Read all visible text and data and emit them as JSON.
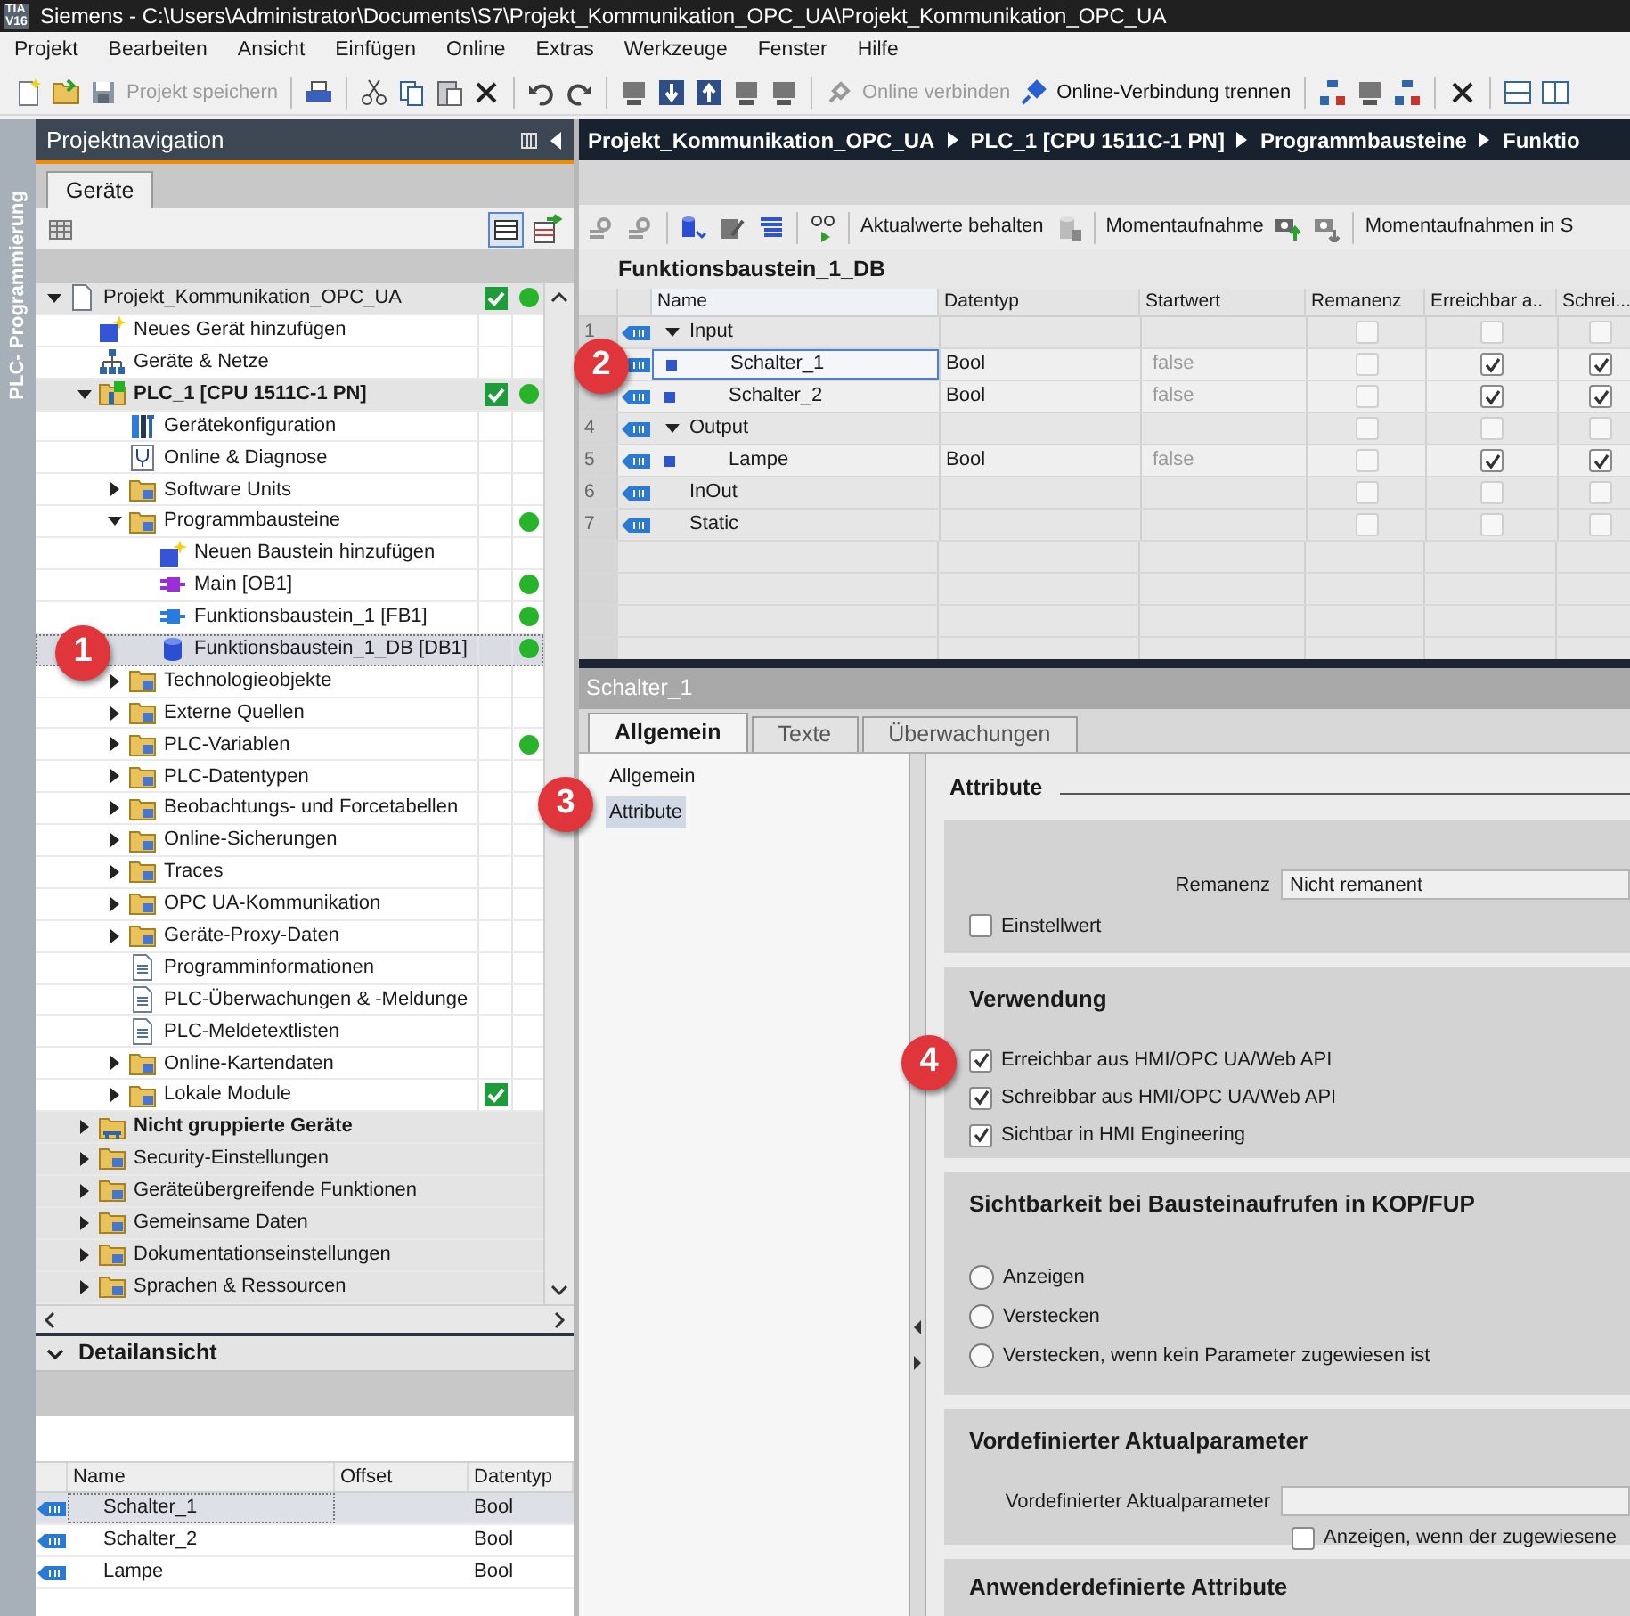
{
  "window": {
    "logo": [
      "TIA",
      "V16"
    ],
    "title": "Siemens  -  C:\\Users\\Administrator\\Documents\\S7\\Projekt_Kommunikation_OPC_UA\\Projekt_Kommunikation_OPC_UA"
  },
  "menu": [
    "Projekt",
    "Bearbeiten",
    "Ansicht",
    "Einfügen",
    "Online",
    "Extras",
    "Werkzeuge",
    "Fenster",
    "Hilfe"
  ],
  "toolbar": [
    {
      "label": "Projekt speichern",
      "disabled": true
    },
    {
      "label": "Online verbinden",
      "disabled": true
    },
    {
      "label": "Online-Verbindung trennen",
      "disabled": false
    }
  ],
  "side_tab": "PLC- Programmierung",
  "project_navigation": {
    "title": "Projektnavigation",
    "tab": "Geräte",
    "tree": [
      {
        "label": "Projekt_Kommunikation_OPC_UA",
        "kind": "project",
        "expanded": true,
        "consistent": true,
        "online_ok": true,
        "selected": false,
        "children": [
          {
            "label": "Neues Gerät hinzufügen",
            "kind": "add",
            "consistent": false,
            "online_ok": false,
            "selected": false
          },
          {
            "label": "Geräte & Netze",
            "kind": "network",
            "consistent": false,
            "online_ok": false,
            "selected": false
          },
          {
            "label": "PLC_1 [CPU 1511C-1 PN]",
            "kind": "device",
            "expanded": true,
            "consistent": true,
            "online_ok": true,
            "selected": false,
            "children": [
              {
                "label": "Gerätekonfiguration",
                "kind": "config",
                "consistent": false,
                "online_ok": false,
                "selected": false
              },
              {
                "label": "Online & Diagnose",
                "kind": "diag",
                "consistent": false,
                "online_ok": false,
                "selected": false
              },
              {
                "label": "Software Units",
                "kind": "folder",
                "expanded": false,
                "consistent": false,
                "online_ok": false,
                "selected": false
              },
              {
                "label": "Programmbausteine",
                "kind": "folder",
                "expanded": true,
                "consistent": false,
                "online_ok": true,
                "selected": false,
                "children": [
                  {
                    "label": "Neuen Baustein hinzufügen",
                    "kind": "add",
                    "consistent": false,
                    "online_ok": false,
                    "selected": false
                  },
                  {
                    "label": "Main [OB1]",
                    "kind": "ob",
                    "consistent": false,
                    "online_ok": true,
                    "selected": false
                  },
                  {
                    "label": "Funktionsbaustein_1 [FB1]",
                    "kind": "fb",
                    "consistent": false,
                    "online_ok": true,
                    "selected": false
                  },
                  {
                    "label": "Funktionsbaustein_1_DB [DB1]",
                    "kind": "db",
                    "consistent": false,
                    "online_ok": true,
                    "selected": true
                  }
                ]
              },
              {
                "label": "Technologieobjekte",
                "kind": "folder",
                "expanded": false,
                "consistent": false,
                "online_ok": false,
                "selected": false
              },
              {
                "label": "Externe Quellen",
                "kind": "folder",
                "expanded": false,
                "consistent": false,
                "online_ok": false,
                "selected": false
              },
              {
                "label": "PLC-Variablen",
                "kind": "folder",
                "expanded": false,
                "consistent": false,
                "online_ok": true,
                "selected": false
              },
              {
                "label": "PLC-Datentypen",
                "kind": "folder",
                "expanded": false,
                "consistent": false,
                "online_ok": false,
                "selected": false
              },
              {
                "label": "Beobachtungs- und Forcetabellen",
                "kind": "folder",
                "expanded": false,
                "consistent": false,
                "online_ok": false,
                "selected": false
              },
              {
                "label": "Online-Sicherungen",
                "kind": "folder",
                "expanded": false,
                "consistent": false,
                "online_ok": false,
                "selected": false
              },
              {
                "label": "Traces",
                "kind": "folder",
                "expanded": false,
                "consistent": false,
                "online_ok": false,
                "selected": false
              },
              {
                "label": "OPC UA-Kommunikation",
                "kind": "folder",
                "expanded": false,
                "consistent": false,
                "online_ok": false,
                "selected": false
              },
              {
                "label": "Geräte-Proxy-Daten",
                "kind": "folder",
                "expanded": false,
                "consistent": false,
                "online_ok": false,
                "selected": false
              },
              {
                "label": "Programminformationen",
                "kind": "doc",
                "consistent": false,
                "online_ok": false,
                "selected": false
              },
              {
                "label": "PLC-Überwachungen & -Meldunge",
                "kind": "doc",
                "consistent": false,
                "online_ok": false,
                "selected": false
              },
              {
                "label": "PLC-Meldetextlisten",
                "kind": "doc",
                "consistent": false,
                "online_ok": false,
                "selected": false
              },
              {
                "label": "Online-Kartendaten",
                "kind": "folder",
                "expanded": false,
                "consistent": false,
                "online_ok": false,
                "selected": false
              },
              {
                "label": "Lokale Module",
                "kind": "folder",
                "expanded": false,
                "consistent": true,
                "online_ok": false,
                "selected": false
              }
            ]
          },
          {
            "label": "Nicht gruppierte Geräte",
            "kind": "group",
            "expanded": false,
            "consistent": false,
            "online_ok": false,
            "selected": false
          },
          {
            "label": "Security-Einstellungen",
            "kind": "folder",
            "expanded": false,
            "consistent": false,
            "online_ok": false,
            "selected": false
          },
          {
            "label": "Geräteübergreifende Funktionen",
            "kind": "folder",
            "expanded": false,
            "consistent": false,
            "online_ok": false,
            "selected": false
          },
          {
            "label": "Gemeinsame Daten",
            "kind": "folder",
            "expanded": false,
            "consistent": false,
            "online_ok": false,
            "selected": false
          },
          {
            "label": "Dokumentationseinstellungen",
            "kind": "folder",
            "expanded": false,
            "consistent": false,
            "online_ok": false,
            "selected": false
          },
          {
            "label": "Sprachen & Ressourcen",
            "kind": "folder",
            "expanded": false,
            "consistent": false,
            "online_ok": false,
            "selected": false
          }
        ]
      }
    ]
  },
  "detail_view": {
    "title": "Detailansicht",
    "columns": [
      "Name",
      "Offset",
      "Datentyp"
    ],
    "rows": [
      {
        "name": "Schalter_1",
        "datatype": "Bool",
        "selected": true
      },
      {
        "name": "Schalter_2",
        "datatype": "Bool",
        "selected": false
      },
      {
        "name": "Lampe",
        "datatype": "Bool",
        "selected": false
      }
    ]
  },
  "breadcrumb": [
    "Projekt_Kommunikation_OPC_UA",
    "PLC_1 [CPU 1511C-1 PN]",
    "Programmbausteine",
    "Funktio"
  ],
  "editor_toolbar": [
    "Aktualwerte behalten",
    "Momentaufnahme",
    "Momentaufnahmen in S"
  ],
  "block": {
    "title": "Funktionsbaustein_1_DB",
    "columns": [
      "Name",
      "Datentyp",
      "Startwert",
      "Remanenz",
      "Erreichbar a..",
      "Schrei..."
    ],
    "rows": [
      {
        "number": "1",
        "name": "Input",
        "kind": "section",
        "expanded": true,
        "remanence": false,
        "accessible": false,
        "writable": false,
        "selected": false,
        "children": [
          {
            "name": "Schalter_1",
            "kind": "member",
            "datatype": "Bool",
            "start_value": "false",
            "remanence": false,
            "accessible": true,
            "writable": true,
            "selected": true
          },
          {
            "name": "Schalter_2",
            "kind": "member",
            "datatype": "Bool",
            "start_value": "false",
            "remanence": false,
            "accessible": true,
            "writable": true,
            "selected": false
          }
        ]
      },
      {
        "number": "4",
        "name": "Output",
        "kind": "section",
        "expanded": true,
        "remanence": false,
        "accessible": false,
        "writable": false,
        "selected": false,
        "children": [
          {
            "number": "5",
            "name": "Lampe",
            "kind": "member",
            "datatype": "Bool",
            "start_value": "false",
            "remanence": false,
            "accessible": true,
            "writable": true,
            "selected": false
          }
        ]
      },
      {
        "number": "6",
        "name": "InOut",
        "kind": "section",
        "remanence": false,
        "accessible": false,
        "writable": false,
        "selected": false
      },
      {
        "number": "7",
        "name": "Static",
        "kind": "section",
        "remanence": false,
        "accessible": false,
        "writable": false,
        "selected": false
      }
    ]
  },
  "properties": {
    "title": "Schalter_1",
    "tabs": [
      {
        "label": "Allgemein",
        "selected": true
      },
      {
        "label": "Texte",
        "selected": false
      },
      {
        "label": "Überwachungen",
        "selected": false
      }
    ],
    "nav": [
      {
        "label": "Allgemein",
        "selected": false
      },
      {
        "label": "Attribute",
        "selected": true
      }
    ],
    "section_title": "Attribute",
    "groups": [
      {
        "items": [
          {
            "kind": "field",
            "label": "Remanenz",
            "value": "Nicht remanent"
          },
          {
            "kind": "checkbox",
            "label": "Einstellwert",
            "checked": false
          }
        ]
      },
      {
        "title": "Verwendung",
        "items": [
          {
            "kind": "checkbox",
            "label": "Erreichbar aus HMI/OPC UA/Web API",
            "checked": true
          },
          {
            "kind": "checkbox",
            "label": "Schreibbar aus HMI/OPC UA/Web API",
            "checked": true
          },
          {
            "kind": "checkbox",
            "label": "Sichtbar in HMI Engineering",
            "checked": true
          }
        ]
      },
      {
        "title": "Sichtbarkeit bei Bausteinaufrufen in KOP/FUP",
        "items": [
          {
            "kind": "radio",
            "label": "Anzeigen",
            "selected": false
          },
          {
            "kind": "radio",
            "label": "Verstecken",
            "selected": false
          },
          {
            "kind": "radio",
            "label": "Verstecken, wenn kein Parameter zugewiesen ist",
            "selected": false
          }
        ]
      },
      {
        "title": "Vordefinierter Aktualparameter",
        "items": [
          {
            "kind": "field",
            "label": "Vordefinierter Aktualparameter"
          },
          {
            "kind": "field_checkbox",
            "label": "Anzeigen, wenn der zugewiesene",
            "checked": false
          }
        ]
      },
      {
        "title": "Anwenderdefinierte Attribute"
      }
    ]
  },
  "annotations": [
    {
      "label": "1"
    },
    {
      "label": "2"
    },
    {
      "label": "3"
    },
    {
      "label": "4"
    }
  ]
}
